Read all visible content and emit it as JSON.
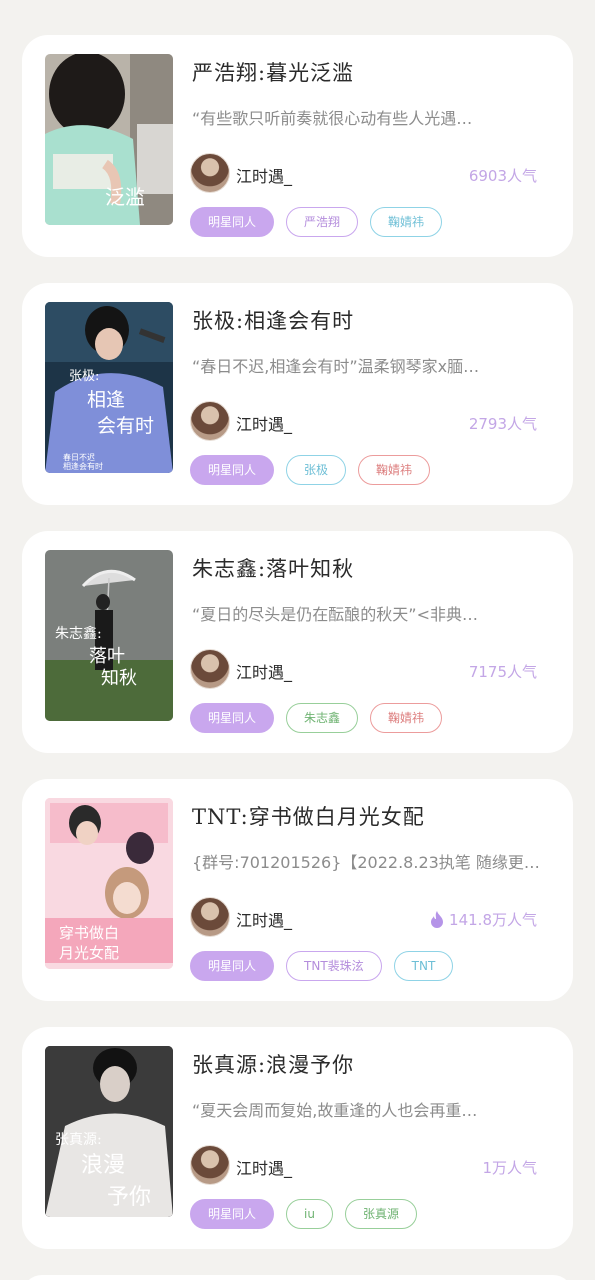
{
  "books": [
    {
      "title": "严浩翔:暮光泛滥",
      "description": "“有些歌只听前奏就很心动有些人光遇…",
      "author": "江时遇_",
      "popularity": "6903人气",
      "hot": false,
      "cover_text": [
        "泛滥"
      ],
      "tags": [
        {
          "label": "明星同人",
          "style": "filled"
        },
        {
          "label": "严浩翔",
          "style": "purple"
        },
        {
          "label": "鞠婧祎",
          "style": "cyan"
        }
      ]
    },
    {
      "title": "张极:相逢会有时",
      "description": "“春日不迟,相逢会有时”温柔钢琴家x腼…",
      "author": "江时遇_",
      "popularity": "2793人气",
      "hot": false,
      "cover_text": [
        "张极:",
        "相逢",
        "会有时",
        "春日不迟",
        "相逢会有时"
      ],
      "tags": [
        {
          "label": "明星同人",
          "style": "filled"
        },
        {
          "label": "张极",
          "style": "cyan"
        },
        {
          "label": "鞠婧祎",
          "style": "red"
        }
      ]
    },
    {
      "title": "朱志鑫:落叶知秋",
      "description": "“夏日的尽头是仍在酝酿的秋天”<非典…",
      "author": "江时遇_",
      "popularity": "7175人气",
      "hot": false,
      "cover_text": [
        "朱志鑫:",
        "落叶",
        "知秋"
      ],
      "tags": [
        {
          "label": "明星同人",
          "style": "filled"
        },
        {
          "label": "朱志鑫",
          "style": "green"
        },
        {
          "label": "鞠婧祎",
          "style": "red"
        }
      ]
    },
    {
      "title": "TNT:穿书做白月光女配",
      "description": "{群号:701201526}【2022.8.23执笔 随缘更】(…",
      "author": "江时遇_",
      "popularity": "141.8万人气",
      "hot": true,
      "cover_text": [
        "穿书做白",
        "月光女配"
      ],
      "tags": [
        {
          "label": "明星同人",
          "style": "filled"
        },
        {
          "label": "TNT裴珠泫",
          "style": "purple"
        },
        {
          "label": "TNT",
          "style": "cyan"
        }
      ]
    },
    {
      "title": "张真源:浪漫予你",
      "description": "“夏天会周而复始,故重逢的人也会再重…",
      "author": "江时遇_",
      "popularity": "1万人气",
      "hot": false,
      "cover_text": [
        "张真源:",
        "浪漫",
        "予你"
      ],
      "tags": [
        {
          "label": "明星同人",
          "style": "filled"
        },
        {
          "label": "iu",
          "style": "green"
        },
        {
          "label": "张真源",
          "style": "green"
        }
      ]
    }
  ],
  "colors": {
    "background": "#f3f2ef",
    "card": "#ffffff",
    "accent_purple": "#c9a7ee",
    "popularity": "#c3a6e6"
  }
}
